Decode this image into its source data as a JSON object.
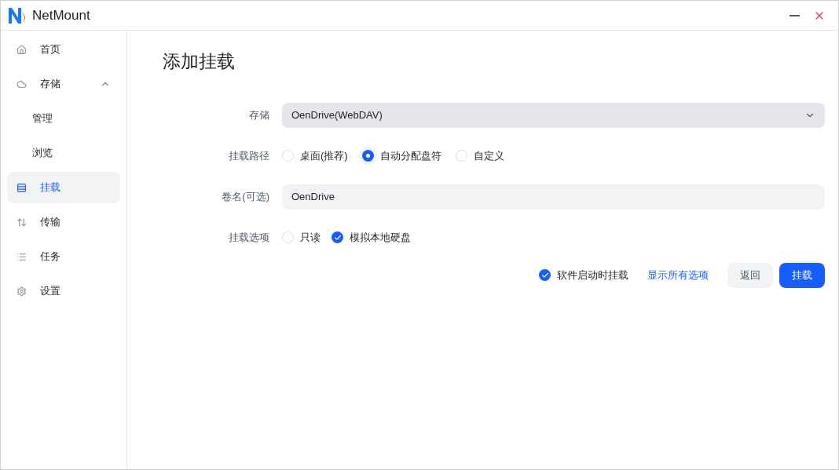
{
  "window": {
    "title": "NetMount"
  },
  "sidebar": {
    "items": [
      {
        "label": "首页",
        "selected": false
      },
      {
        "label": "存储",
        "selected": false,
        "expanded": true,
        "children": [
          {
            "label": "管理",
            "selected": false
          },
          {
            "label": "浏览",
            "selected": false
          }
        ]
      },
      {
        "label": "挂载",
        "selected": true
      },
      {
        "label": "传输",
        "selected": false
      },
      {
        "label": "任务",
        "selected": false
      },
      {
        "label": "设置",
        "selected": false
      }
    ]
  },
  "page": {
    "title": "添加挂载",
    "storage": {
      "label": "存储",
      "value": "OenDrive(WebDAV)"
    },
    "mount_path": {
      "label": "挂载路径",
      "options": [
        {
          "label": "桌面(推荐)",
          "selected": false
        },
        {
          "label": "自动分配盘符",
          "selected": true
        },
        {
          "label": "自定义",
          "selected": false
        }
      ]
    },
    "volume_name": {
      "label": "卷名(可选)",
      "value": "OenDrive"
    },
    "mount_options": {
      "label": "挂载选项",
      "options": [
        {
          "label": "只读",
          "checked": false
        },
        {
          "label": "模拟本地硬盘",
          "checked": true
        }
      ]
    },
    "auto_mount": {
      "label": "软件启动时挂载",
      "checked": true
    },
    "show_all_link": "显示所有选项",
    "buttons": [
      {
        "label": "返回",
        "kind": "secondary"
      },
      {
        "label": "挂载",
        "kind": "primary"
      }
    ]
  }
}
